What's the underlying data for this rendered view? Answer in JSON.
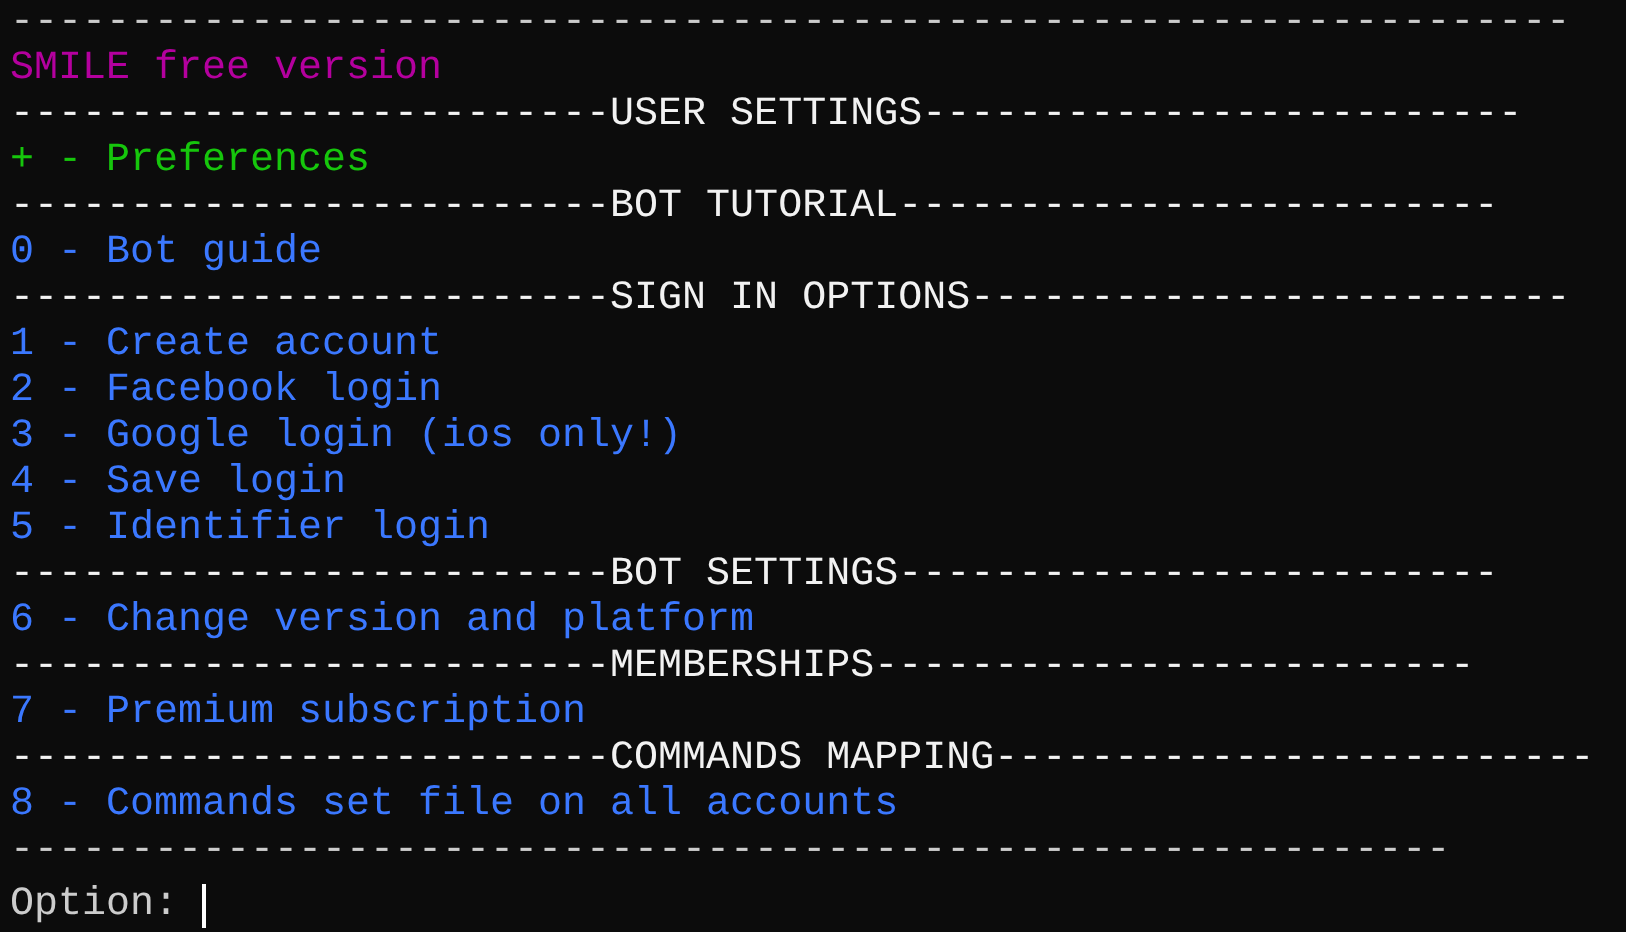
{
  "lines": [
    {
      "kind": "rule",
      "text": "-----------------------------------------------------------------"
    },
    {
      "kind": "title",
      "text": "SMILE free version"
    },
    {
      "kind": "header",
      "text": "-------------------------USER SETTINGS-------------------------"
    },
    {
      "kind": "option",
      "text": "+ - Preferences",
      "color": "#16c60c"
    },
    {
      "kind": "header",
      "text": "-------------------------BOT TUTORIAL-------------------------"
    },
    {
      "kind": "option",
      "text": "0 - Bot guide",
      "color": "#3b78ff"
    },
    {
      "kind": "header",
      "text": "-------------------------SIGN IN OPTIONS-------------------------"
    },
    {
      "kind": "option",
      "text": "1 - Create account",
      "color": "#3b78ff"
    },
    {
      "kind": "option",
      "text": "2 - Facebook login",
      "color": "#3b78ff"
    },
    {
      "kind": "option",
      "text": "3 - Google login (ios only!)",
      "color": "#3b78ff"
    },
    {
      "kind": "option",
      "text": "4 - Save login",
      "color": "#3b78ff"
    },
    {
      "kind": "option",
      "text": "5 - Identifier login",
      "color": "#3b78ff"
    },
    {
      "kind": "header",
      "text": "-------------------------BOT SETTINGS-------------------------"
    },
    {
      "kind": "option",
      "text": "6 - Change version and platform",
      "color": "#3b78ff"
    },
    {
      "kind": "header",
      "text": "-------------------------MEMBERSHIPS-------------------------"
    },
    {
      "kind": "option",
      "text": "7 - Premium subscription",
      "color": "#3b78ff"
    },
    {
      "kind": "header",
      "text": "-------------------------COMMANDS MAPPING-------------------------"
    },
    {
      "kind": "option",
      "text": "8 - Commands set file on all accounts",
      "color": "#3b78ff"
    },
    {
      "kind": "rule",
      "text": "------------------------------------------------------------"
    },
    {
      "kind": "prompt",
      "text": "Option:"
    }
  ]
}
